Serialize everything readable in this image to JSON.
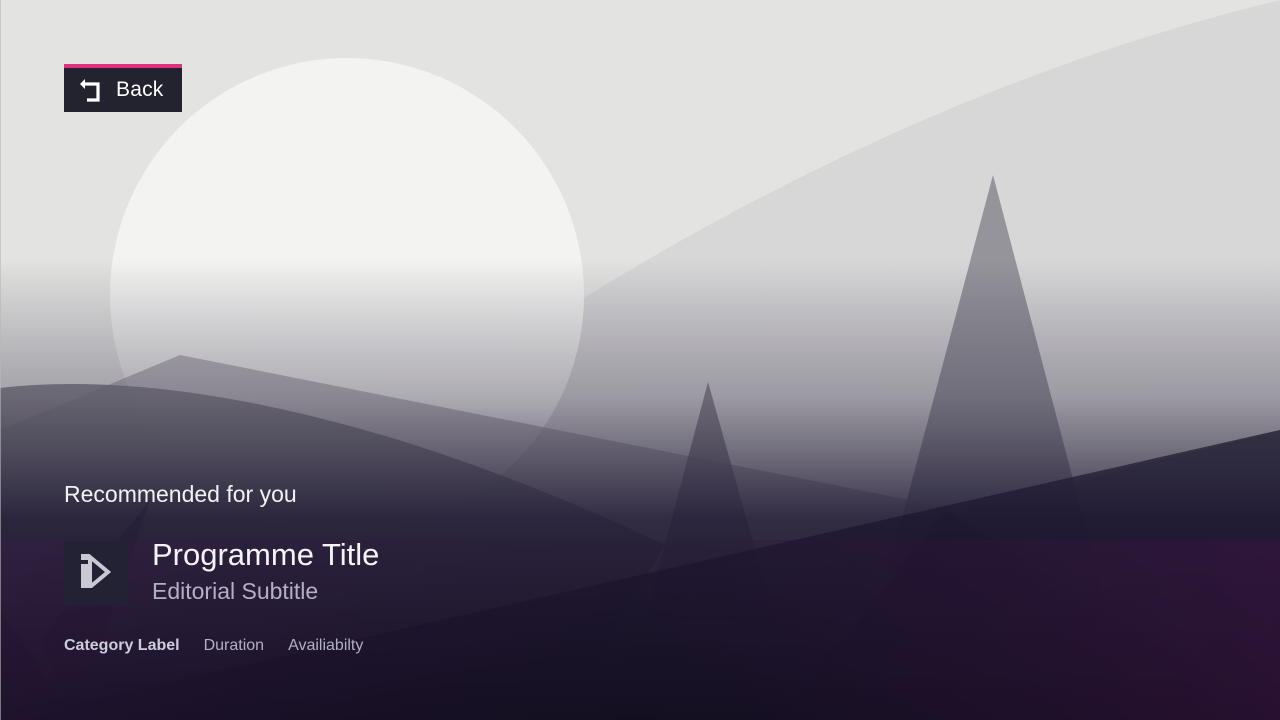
{
  "back_button": {
    "label": "Back",
    "icon": "back-arrow-icon"
  },
  "recommendations": {
    "heading": "Recommended for you",
    "item": {
      "thumbnail_icon": "programme-logo-icon",
      "title": "Programme Title",
      "subtitle": "Editorial Subtitle",
      "category": "Category Label",
      "duration": "Duration",
      "availability": "Availiabilty"
    }
  },
  "colors": {
    "accent": "#e0317f",
    "panel": "#23222f",
    "background": "#e3e3e1",
    "subtitle_text": "#b3b0c6"
  }
}
